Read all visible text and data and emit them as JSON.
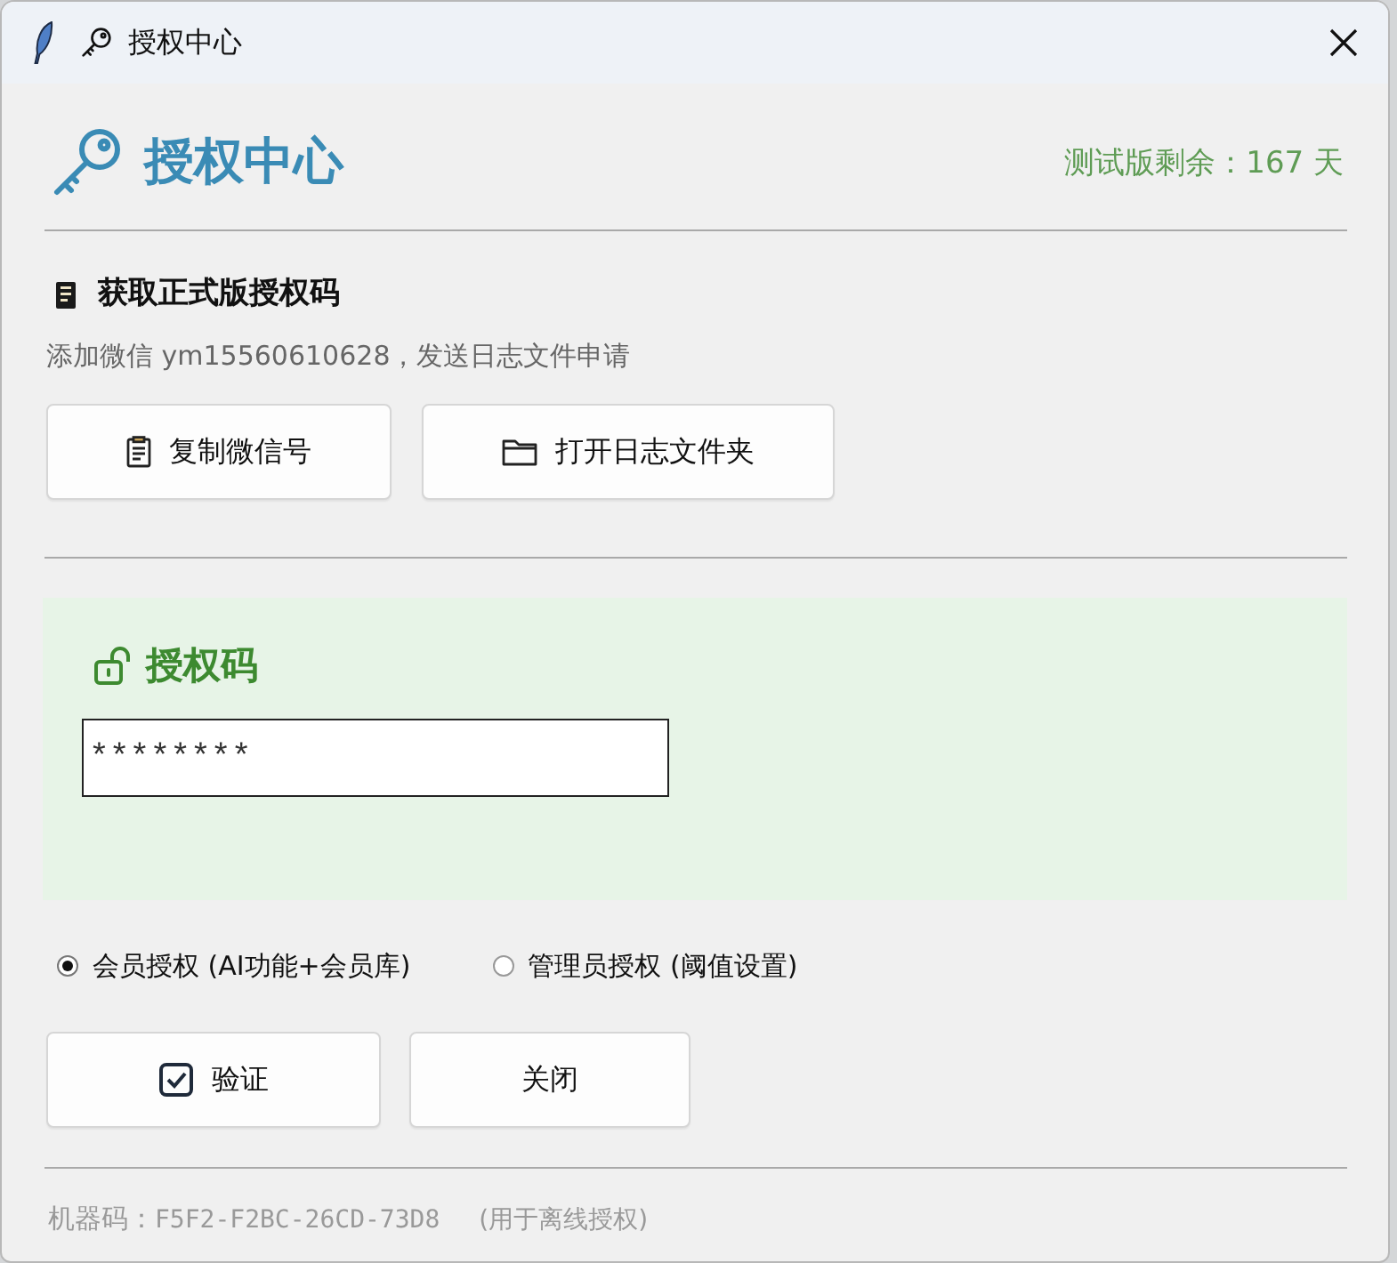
{
  "window": {
    "title": "授权中心"
  },
  "header": {
    "title": "授权中心",
    "trial": "测试版剩余：167 天"
  },
  "get_license": {
    "title": "获取正式版授权码",
    "hint": "添加微信 ym15560610628，发送日志文件申请",
    "buttons": [
      {
        "label": "复制微信号",
        "kind": "clipboard"
      },
      {
        "label": "打开日志文件夹",
        "kind": "folder"
      }
    ]
  },
  "license_code": {
    "title": "授权码",
    "value": "********"
  },
  "license_types": [
    {
      "label": "会员授权 (AI功能+会员库)",
      "selected": true
    },
    {
      "label": "管理员授权 (阈值设置)",
      "selected": false
    }
  ],
  "actions": [
    {
      "label": "验证",
      "kind": "check"
    },
    {
      "label": "关闭",
      "kind": "plain"
    }
  ],
  "footer": {
    "label": "机器码：",
    "machine_code": "F5F2-F2BC-26CD-73D8",
    "note": "(用于离线授权)"
  }
}
